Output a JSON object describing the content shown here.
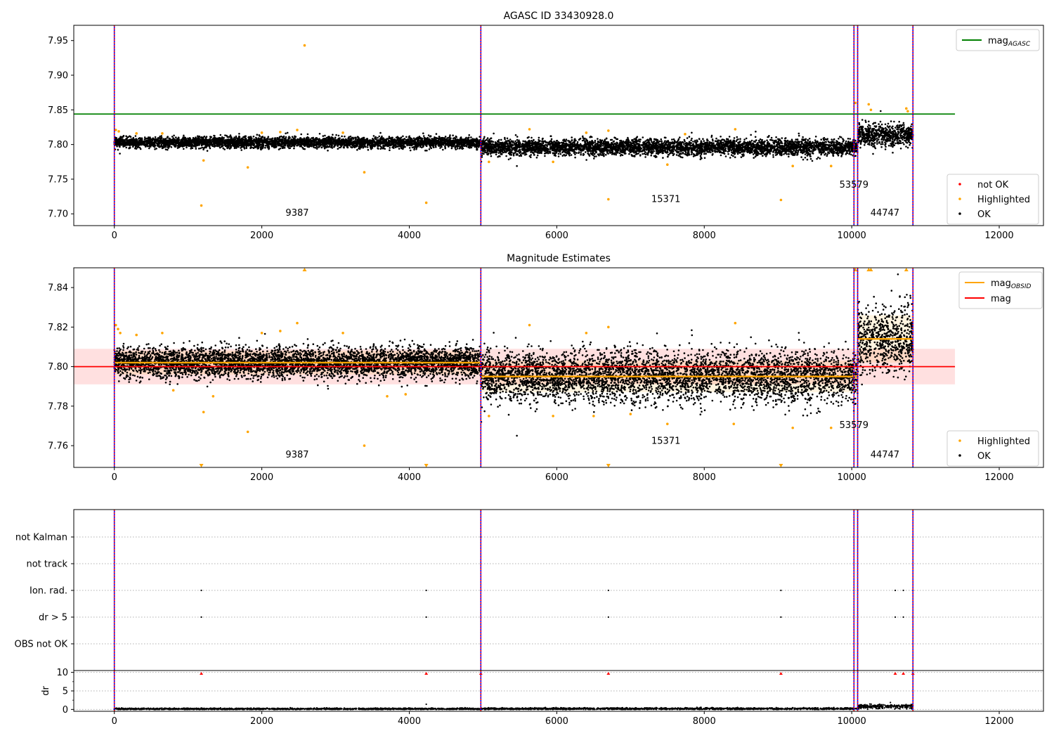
{
  "chart_data": [
    {
      "type": "scatter",
      "title": "AGASC ID 33430928.0",
      "xlim": [
        -550,
        12600
      ],
      "ylim": [
        7.683,
        7.972
      ],
      "xticks": [
        "0",
        "2000",
        "4000",
        "6000",
        "8000",
        "10000",
        "12000"
      ],
      "xtick_values": [
        0,
        2000,
        4000,
        6000,
        8000,
        10000,
        12000
      ],
      "yticks": [
        "7.70",
        "7.75",
        "7.80",
        "7.85",
        "7.90",
        "7.95"
      ],
      "ytick_values": [
        7.7,
        7.75,
        7.8,
        7.85,
        7.9,
        7.95
      ],
      "grid": false,
      "vlines": [
        0,
        4970,
        10030,
        10080,
        10830
      ],
      "mag_agasc": 7.844,
      "mag_agasc_xrange": [
        -550,
        11400
      ],
      "ok_segments": [
        {
          "x0": 0,
          "x1": 4970,
          "level": 7.803,
          "spread": 0.006
        },
        {
          "x0": 4970,
          "x1": 10080,
          "level": 7.796,
          "spread": 0.009
        },
        {
          "x0": 10080,
          "x1": 10830,
          "level": 7.814,
          "spread": 0.012
        }
      ],
      "highlighted": [
        {
          "x": 20,
          "y": 7.821
        },
        {
          "x": 60,
          "y": 7.819
        },
        {
          "x": 300,
          "y": 7.816
        },
        {
          "x": 650,
          "y": 7.816
        },
        {
          "x": 1180,
          "y": 7.712
        },
        {
          "x": 1210,
          "y": 7.777
        },
        {
          "x": 1810,
          "y": 7.767
        },
        {
          "x": 2000,
          "y": 7.817
        },
        {
          "x": 2250,
          "y": 7.818
        },
        {
          "x": 2480,
          "y": 7.821
        },
        {
          "x": 2580,
          "y": 7.943
        },
        {
          "x": 3100,
          "y": 7.817
        },
        {
          "x": 3390,
          "y": 7.76
        },
        {
          "x": 4230,
          "y": 7.716
        },
        {
          "x": 5080,
          "y": 7.775
        },
        {
          "x": 5630,
          "y": 7.822
        },
        {
          "x": 5950,
          "y": 7.775
        },
        {
          "x": 6400,
          "y": 7.817
        },
        {
          "x": 6700,
          "y": 7.721
        },
        {
          "x": 6700,
          "y": 7.82
        },
        {
          "x": 7500,
          "y": 7.771
        },
        {
          "x": 7740,
          "y": 7.815
        },
        {
          "x": 8420,
          "y": 7.822
        },
        {
          "x": 9040,
          "y": 7.72
        },
        {
          "x": 9200,
          "y": 7.769
        },
        {
          "x": 9720,
          "y": 7.769
        },
        {
          "x": 10050,
          "y": 7.86
        },
        {
          "x": 10230,
          "y": 7.858
        },
        {
          "x": 10260,
          "y": 7.85
        },
        {
          "x": 10740,
          "y": 7.852
        },
        {
          "x": 10760,
          "y": 7.848
        }
      ],
      "not_ok": [],
      "obsid_labels": [
        {
          "text": "9387",
          "x": 2480,
          "y": 7.697
        },
        {
          "text": "15371",
          "x": 7480,
          "y": 7.717
        },
        {
          "text": "53579",
          "x": 10030,
          "y": 7.738
        },
        {
          "text": "44747",
          "x": 10450,
          "y": 7.697
        }
      ],
      "legend_top": [
        {
          "label": "mag",
          "sub": "AGASC",
          "color": "#008000"
        }
      ],
      "legend_bottom": [
        {
          "label": "not OK",
          "color": "#ff0000"
        },
        {
          "label": "Highlighted",
          "color": "#ffa500"
        },
        {
          "label": "OK",
          "color": "#000000"
        }
      ],
      "legend_top_position": "upper right",
      "legend_bottom_position": "lower right"
    },
    {
      "type": "scatter",
      "title": "Magnitude Estimates",
      "xlim": [
        -550,
        12600
      ],
      "ylim": [
        7.749,
        7.85
      ],
      "xticks": [
        "0",
        "2000",
        "4000",
        "6000",
        "8000",
        "10000",
        "12000"
      ],
      "xtick_values": [
        0,
        2000,
        4000,
        6000,
        8000,
        10000,
        12000
      ],
      "yticks": [
        "7.76",
        "7.78",
        "7.80",
        "7.82",
        "7.84"
      ],
      "ytick_values": [
        7.76,
        7.78,
        7.8,
        7.82,
        7.84
      ],
      "grid": false,
      "vlines": [
        0,
        4970,
        10030,
        10080,
        10830
      ],
      "mag": 7.8,
      "mag_band": [
        7.791,
        7.809
      ],
      "mag_xrange": [
        -550,
        11400
      ],
      "mag_obsid": [
        {
          "x0": 0,
          "x1": 4970,
          "y": 7.802,
          "band": [
            7.796,
            7.808
          ]
        },
        {
          "x0": 4970,
          "x1": 10080,
          "y": 7.795,
          "band": [
            7.787,
            7.803
          ]
        },
        {
          "x0": 10080,
          "x1": 10830,
          "y": 7.814,
          "band": [
            7.802,
            7.826
          ]
        }
      ],
      "ok_segments": [
        {
          "x0": 0,
          "x1": 4970,
          "level": 7.802,
          "spread": 0.006
        },
        {
          "x0": 4970,
          "x1": 10080,
          "level": 7.795,
          "spread": 0.01
        },
        {
          "x0": 10080,
          "x1": 10830,
          "level": 7.814,
          "spread": 0.013
        }
      ],
      "highlighted": [
        {
          "x": 20,
          "y": 7.821
        },
        {
          "x": 50,
          "y": 7.819
        },
        {
          "x": 80,
          "y": 7.817
        },
        {
          "x": 300,
          "y": 7.816
        },
        {
          "x": 650,
          "y": 7.817
        },
        {
          "x": 800,
          "y": 7.788
        },
        {
          "x": 1210,
          "y": 7.777
        },
        {
          "x": 1340,
          "y": 7.785
        },
        {
          "x": 1810,
          "y": 7.767
        },
        {
          "x": 2000,
          "y": 7.817
        },
        {
          "x": 2250,
          "y": 7.818
        },
        {
          "x": 2480,
          "y": 7.822
        },
        {
          "x": 3100,
          "y": 7.817
        },
        {
          "x": 3390,
          "y": 7.76
        },
        {
          "x": 3700,
          "y": 7.785
        },
        {
          "x": 3950,
          "y": 7.786
        },
        {
          "x": 5080,
          "y": 7.775
        },
        {
          "x": 5630,
          "y": 7.821
        },
        {
          "x": 5950,
          "y": 7.775
        },
        {
          "x": 6400,
          "y": 7.817
        },
        {
          "x": 6500,
          "y": 7.775
        },
        {
          "x": 6700,
          "y": 7.82
        },
        {
          "x": 7000,
          "y": 7.776
        },
        {
          "x": 7500,
          "y": 7.771
        },
        {
          "x": 8420,
          "y": 7.822
        },
        {
          "x": 8400,
          "y": 7.771
        },
        {
          "x": 9200,
          "y": 7.769
        },
        {
          "x": 9720,
          "y": 7.769
        }
      ],
      "clipped_high": [
        2580,
        10050,
        10230,
        10260,
        10740
      ],
      "clipped_low": [
        1180,
        4230,
        6700,
        9040
      ],
      "obsid_labels": [
        {
          "text": "9387",
          "x": 2480,
          "y": 7.754
        },
        {
          "text": "15371",
          "x": 7480,
          "y": 7.761
        },
        {
          "text": "53579",
          "x": 10030,
          "y": 7.769
        },
        {
          "text": "44747",
          "x": 10450,
          "y": 7.754
        }
      ],
      "legend_top": [
        {
          "label": "mag",
          "sub": "OBSID",
          "color": "#ffa500"
        },
        {
          "label": "mag",
          "sub": "",
          "color": "#ff0000"
        }
      ],
      "legend_bottom": [
        {
          "label": "Highlighted",
          "color": "#ffa500"
        },
        {
          "label": "OK",
          "color": "#000000"
        }
      ],
      "legend_top_position": "upper right",
      "legend_bottom_position": "lower right"
    },
    {
      "type": "scatter",
      "xlim": [
        -550,
        12600
      ],
      "flag_rows": [
        "not Kalman",
        "not track",
        "Ion. rad.",
        "dr > 5",
        "OBS not OK"
      ],
      "flag_points": {
        "not Kalman": [
          4970
        ],
        "not track": [],
        "Ion. rad.": [
          1180,
          4230,
          6700,
          9040,
          10590,
          10700,
          10830
        ],
        "dr > 5": [
          1180,
          4230,
          6700,
          9040,
          10590,
          10700,
          10830
        ],
        "OBS not OK": []
      },
      "vlines": [
        0,
        4970,
        10030,
        10080,
        10830
      ],
      "grid": true
    },
    {
      "type": "scatter",
      "ylabel": "dr",
      "xlim": [
        -550,
        12600
      ],
      "ylim": [
        -0.5,
        10.5
      ],
      "yticks": [
        "0",
        "5",
        "10"
      ],
      "ytick_values": [
        0,
        5,
        10
      ],
      "xticks": [
        "0",
        "2000",
        "4000",
        "6000",
        "8000",
        "10000",
        "12000"
      ],
      "xtick_values": [
        0,
        2000,
        4000,
        6000,
        8000,
        10000,
        12000
      ],
      "clipped_high": [
        1180,
        4230,
        4970,
        6700,
        9040,
        10590,
        10700,
        10830
      ],
      "dr_segments": [
        {
          "x0": 0,
          "x1": 4970,
          "level": 0.15,
          "spread": 0.1
        },
        {
          "x0": 4970,
          "x1": 10080,
          "level": 0.2,
          "spread": 0.12
        },
        {
          "x0": 10080,
          "x1": 10830,
          "level": 0.8,
          "spread": 0.3
        }
      ],
      "vlines": [
        0,
        4970,
        10030,
        10080,
        10830
      ],
      "grid": true
    }
  ]
}
